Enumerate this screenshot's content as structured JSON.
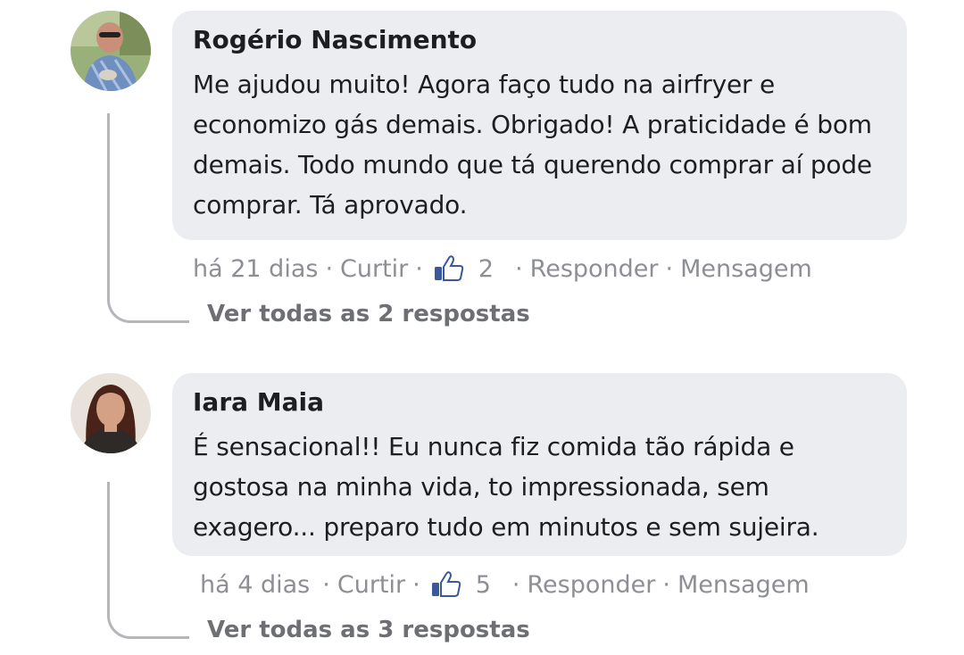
{
  "comments": [
    {
      "author": "Rogério Nascimento",
      "text": "Me ajudou muito! Agora faço tudo na airfryer e economizo gás demais. Obrigado! A praticidade é bom demais. Todo mundo que tá querendo comprar aí pode comprar. Tá aprovado.",
      "time": "há 21 dias",
      "like_label": "Curtir",
      "likes": "2",
      "reply_label": "Responder",
      "message_label": "Mensagem",
      "view_replies": "Ver todas as 2 respostas",
      "avatar_icon": "avatar-photo"
    },
    {
      "author": "Iara Maia",
      "text": "É sensacional!! Eu nunca fiz comida tão rápida e gostosa na minha vida, to impressionada, sem exagero... preparo tudo em minutos e sem sujeira.",
      "time": "há 4 dias",
      "like_label": "Curtir",
      "likes": "5",
      "reply_label": "Responder",
      "message_label": "Mensagem",
      "view_replies": "Ver todas as 3 respostas",
      "avatar_icon": "avatar-photo"
    }
  ],
  "separator": "·",
  "colors": {
    "bubble": "#ecedf1",
    "meta_text": "#8d8f94",
    "thumbs_up": "#3b5998"
  }
}
